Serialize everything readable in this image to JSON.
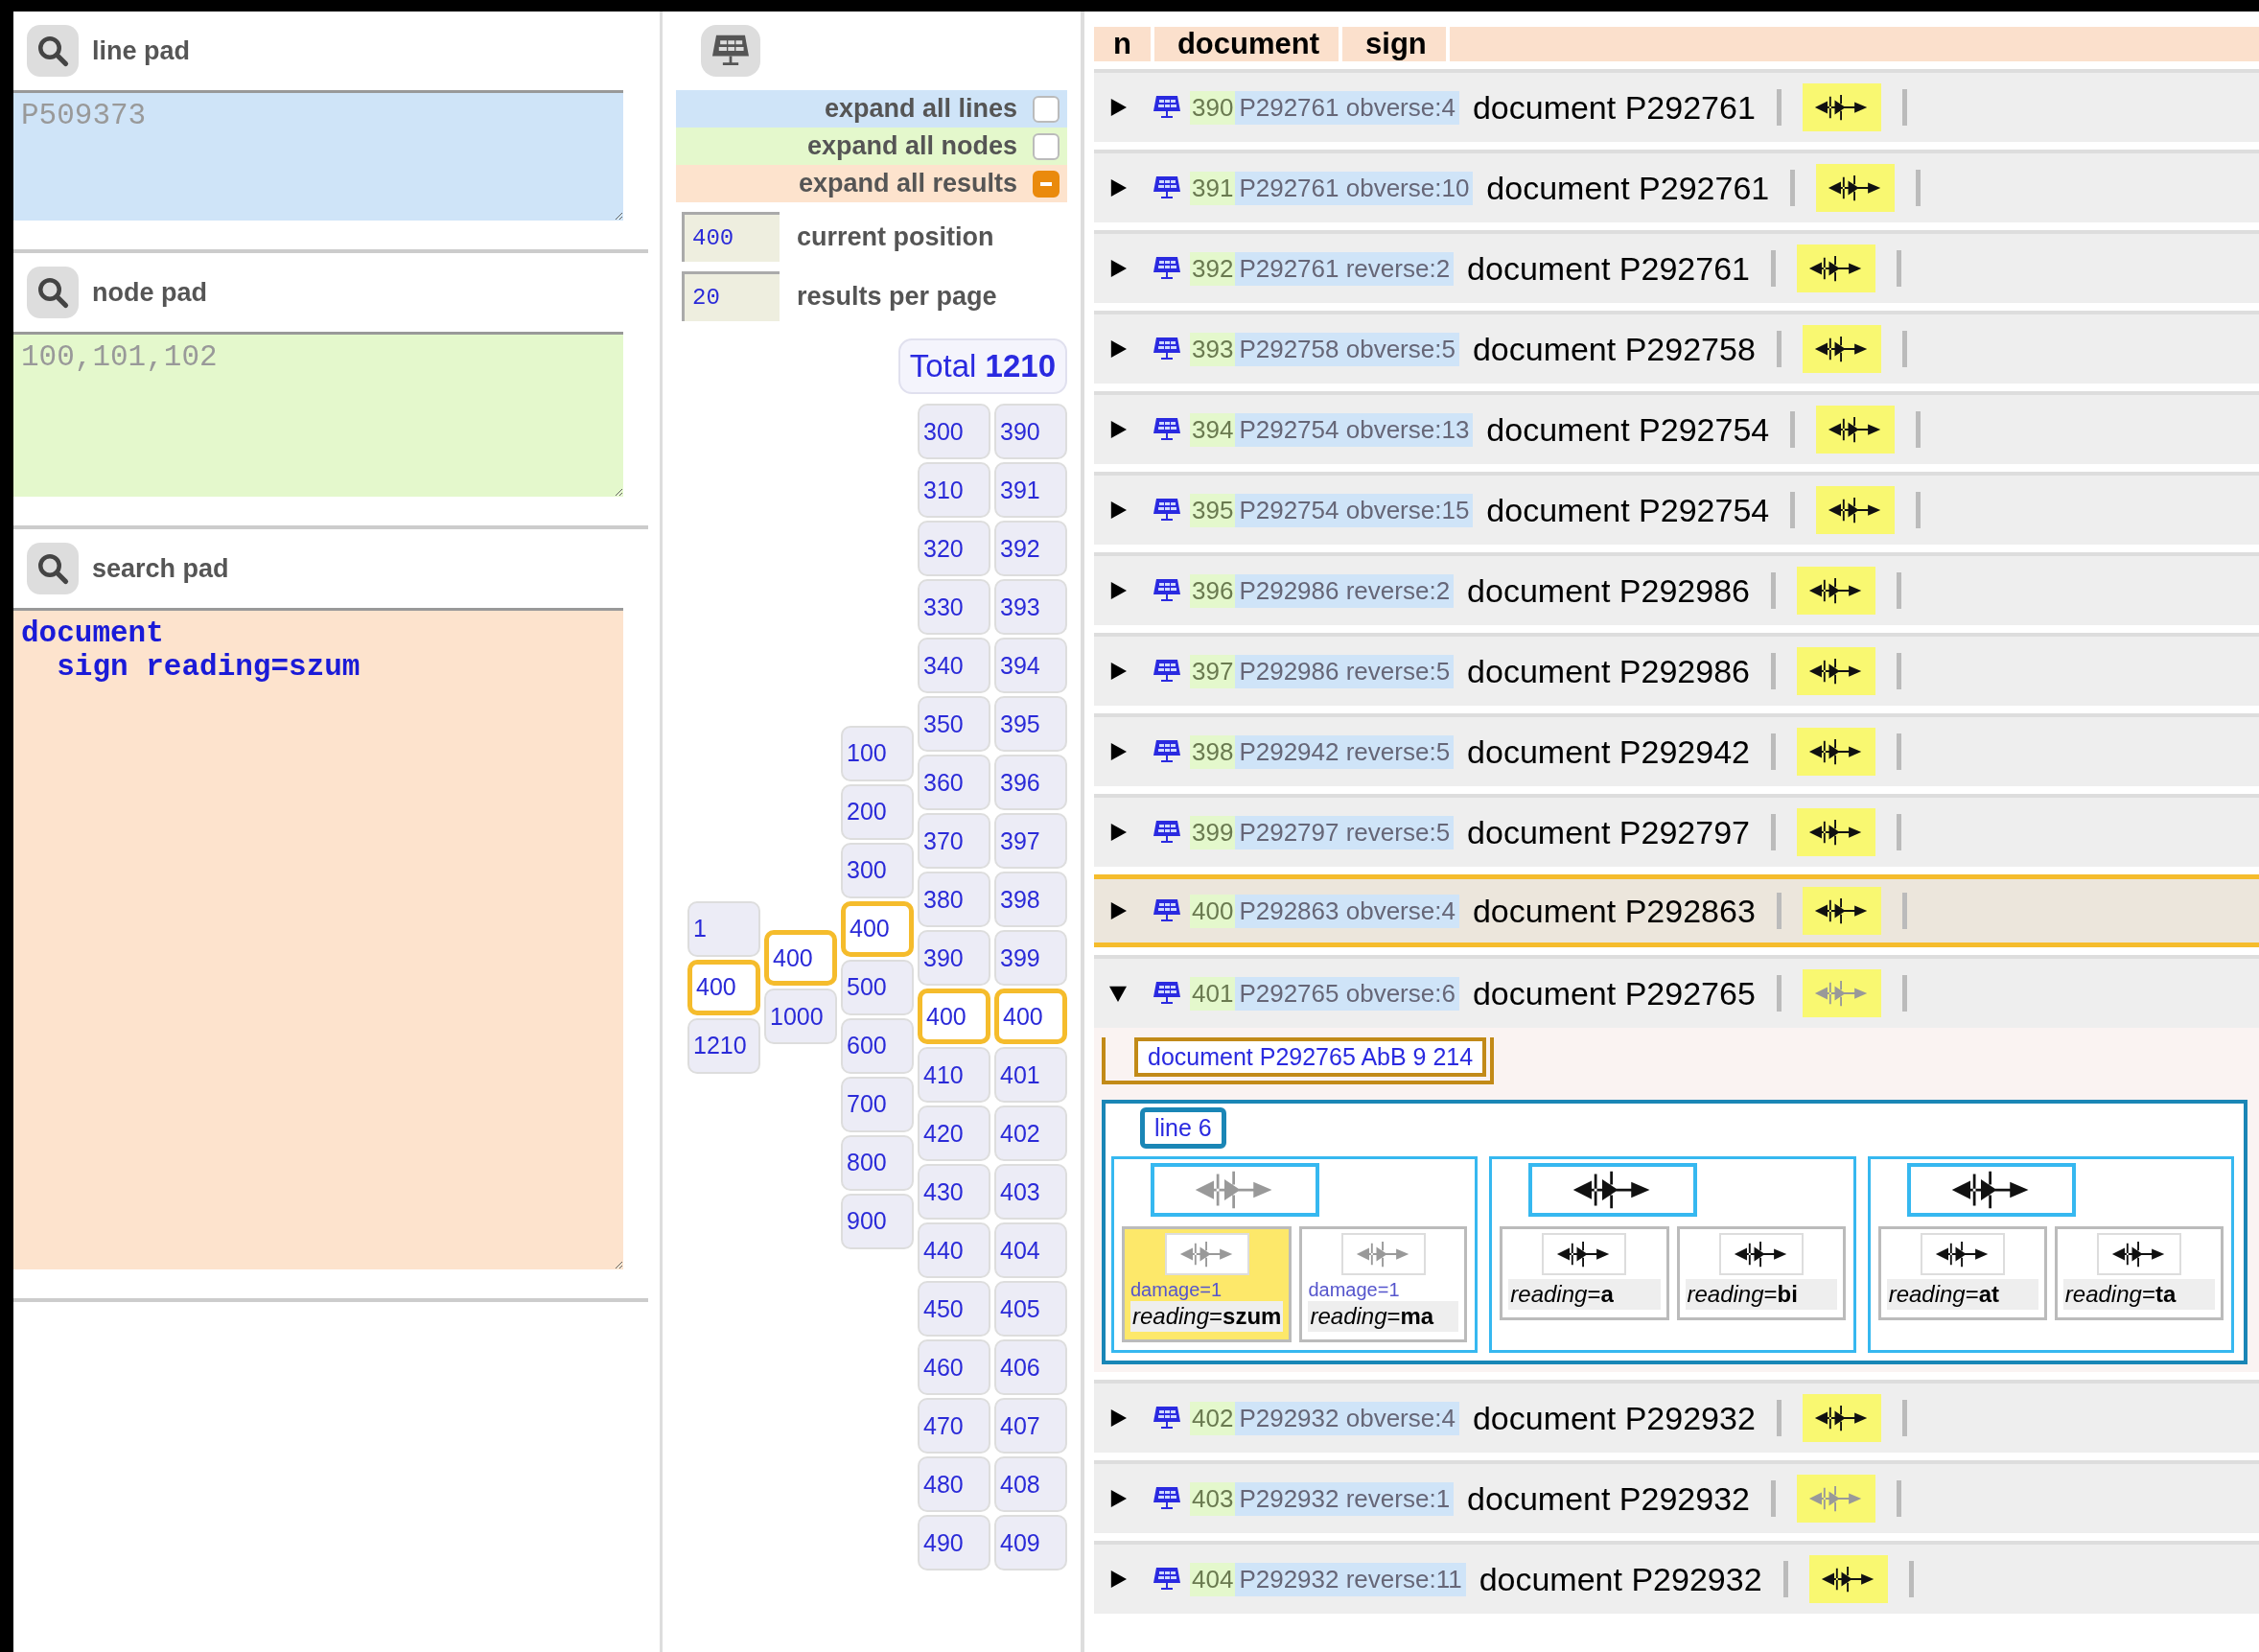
{
  "pads": [
    {
      "kind": "line",
      "title": "line pad",
      "placeholder": "P509373"
    },
    {
      "kind": "node",
      "title": "node pad",
      "placeholder": "100,101,102"
    },
    {
      "kind": "search",
      "title": "search pad",
      "value": "document\n  sign reading=szum"
    }
  ],
  "controls": {
    "options": [
      {
        "kind": "lines",
        "label": "expand all lines",
        "checked": false
      },
      {
        "kind": "nodes",
        "label": "expand all nodes",
        "checked": false
      },
      {
        "kind": "results",
        "label": "expand all results",
        "checked": true
      }
    ],
    "fields": [
      {
        "value": "400",
        "label": "current position"
      },
      {
        "value": "20",
        "label": "results per page"
      }
    ],
    "total": {
      "label": "Total",
      "value": "1210"
    }
  },
  "pager": {
    "columns": [
      {
        "items": [
          {
            "label": "1",
            "selected": false
          },
          {
            "label": "400",
            "selected": true
          },
          {
            "label": "1210",
            "selected": false
          }
        ]
      },
      {
        "items": [
          {
            "label": "400",
            "selected": true
          },
          {
            "label": "1000",
            "selected": false
          }
        ]
      },
      {
        "items": [
          {
            "label": "100",
            "selected": false
          },
          {
            "label": "200",
            "selected": false
          },
          {
            "label": "300",
            "selected": false
          },
          {
            "label": "400",
            "selected": true
          },
          {
            "label": "500",
            "selected": false
          },
          {
            "label": "600",
            "selected": false
          },
          {
            "label": "700",
            "selected": false
          },
          {
            "label": "800",
            "selected": false
          },
          {
            "label": "900",
            "selected": false
          }
        ]
      },
      {
        "items": [
          {
            "label": "300",
            "selected": false
          },
          {
            "label": "310",
            "selected": false
          },
          {
            "label": "320",
            "selected": false
          },
          {
            "label": "330",
            "selected": false
          },
          {
            "label": "340",
            "selected": false
          },
          {
            "label": "350",
            "selected": false
          },
          {
            "label": "360",
            "selected": false
          },
          {
            "label": "370",
            "selected": false
          },
          {
            "label": "380",
            "selected": false
          },
          {
            "label": "390",
            "selected": false
          },
          {
            "label": "400",
            "selected": true
          },
          {
            "label": "410",
            "selected": false
          },
          {
            "label": "420",
            "selected": false
          },
          {
            "label": "430",
            "selected": false
          },
          {
            "label": "440",
            "selected": false
          },
          {
            "label": "450",
            "selected": false
          },
          {
            "label": "460",
            "selected": false
          },
          {
            "label": "470",
            "selected": false
          },
          {
            "label": "480",
            "selected": false
          },
          {
            "label": "490",
            "selected": false
          }
        ]
      },
      {
        "items": [
          {
            "label": "390",
            "selected": false
          },
          {
            "label": "391",
            "selected": false
          },
          {
            "label": "392",
            "selected": false
          },
          {
            "label": "393",
            "selected": false
          },
          {
            "label": "394",
            "selected": false
          },
          {
            "label": "395",
            "selected": false
          },
          {
            "label": "396",
            "selected": false
          },
          {
            "label": "397",
            "selected": false
          },
          {
            "label": "398",
            "selected": false
          },
          {
            "label": "399",
            "selected": false
          },
          {
            "label": "400",
            "selected": true
          },
          {
            "label": "401",
            "selected": false
          },
          {
            "label": "402",
            "selected": false
          },
          {
            "label": "403",
            "selected": false
          },
          {
            "label": "404",
            "selected": false
          },
          {
            "label": "405",
            "selected": false
          },
          {
            "label": "406",
            "selected": false
          },
          {
            "label": "407",
            "selected": false
          },
          {
            "label": "408",
            "selected": false
          },
          {
            "label": "409",
            "selected": false
          }
        ]
      }
    ]
  },
  "results": {
    "columns": [
      "n",
      "document",
      "sign"
    ],
    "rows": [
      {
        "n": "390",
        "ref": "P292761 obverse:4",
        "document": "document P292761",
        "expanded": false,
        "selected": false,
        "faded": false
      },
      {
        "n": "391",
        "ref": "P292761 obverse:10",
        "document": "document P292761",
        "expanded": false,
        "selected": false,
        "faded": false
      },
      {
        "n": "392",
        "ref": "P292761 reverse:2",
        "document": "document P292761",
        "expanded": false,
        "selected": false,
        "faded": false
      },
      {
        "n": "393",
        "ref": "P292758 obverse:5",
        "document": "document P292758",
        "expanded": false,
        "selected": false,
        "faded": false
      },
      {
        "n": "394",
        "ref": "P292754 obverse:13",
        "document": "document P292754",
        "expanded": false,
        "selected": false,
        "faded": false
      },
      {
        "n": "395",
        "ref": "P292754 obverse:15",
        "document": "document P292754",
        "expanded": false,
        "selected": false,
        "faded": false
      },
      {
        "n": "396",
        "ref": "P292986 reverse:2",
        "document": "document P292986",
        "expanded": false,
        "selected": false,
        "faded": false
      },
      {
        "n": "397",
        "ref": "P292986 reverse:5",
        "document": "document P292986",
        "expanded": false,
        "selected": false,
        "faded": false
      },
      {
        "n": "398",
        "ref": "P292942 reverse:5",
        "document": "document P292942",
        "expanded": false,
        "selected": false,
        "faded": false
      },
      {
        "n": "399",
        "ref": "P292797 reverse:5",
        "document": "document P292797",
        "expanded": false,
        "selected": false,
        "faded": false
      },
      {
        "n": "400",
        "ref": "P292863 obverse:4",
        "document": "document P292863",
        "expanded": false,
        "selected": true,
        "faded": false
      },
      {
        "n": "401",
        "ref": "P292765 obverse:6",
        "document": "document P292765",
        "expanded": true,
        "selected": false,
        "faded": true,
        "detail": {
          "document": "document P292765 AbB 9 214",
          "line": "line 6",
          "words": [
            {
              "faded": true,
              "signs": [
                {
                  "damage": "damage=1",
                  "reading": "*reading*=**szum**",
                  "highlighted": true
                },
                {
                  "damage": "damage=1",
                  "reading": "*reading*=**ma**",
                  "highlighted": false
                }
              ]
            },
            {
              "faded": false,
              "signs": [
                {
                  "reading": "*reading*=**a**",
                  "highlighted": false
                },
                {
                  "reading": "*reading*=**bi**",
                  "highlighted": false
                }
              ]
            },
            {
              "faded": false,
              "signs": [
                {
                  "reading": "*reading*=**at**",
                  "highlighted": false
                },
                {
                  "reading": "*reading*=**ta**",
                  "highlighted": false
                }
              ]
            }
          ]
        }
      },
      {
        "n": "402",
        "ref": "P292932 obverse:4",
        "document": "document P292932",
        "expanded": false,
        "selected": false,
        "faded": false
      },
      {
        "n": "403",
        "ref": "P292932 reverse:1",
        "document": "document P292932",
        "expanded": false,
        "selected": false,
        "faded": true
      },
      {
        "n": "404",
        "ref": "P292932 reverse:11",
        "document": "document P292932",
        "expanded": false,
        "selected": false,
        "faded": false
      }
    ]
  }
}
